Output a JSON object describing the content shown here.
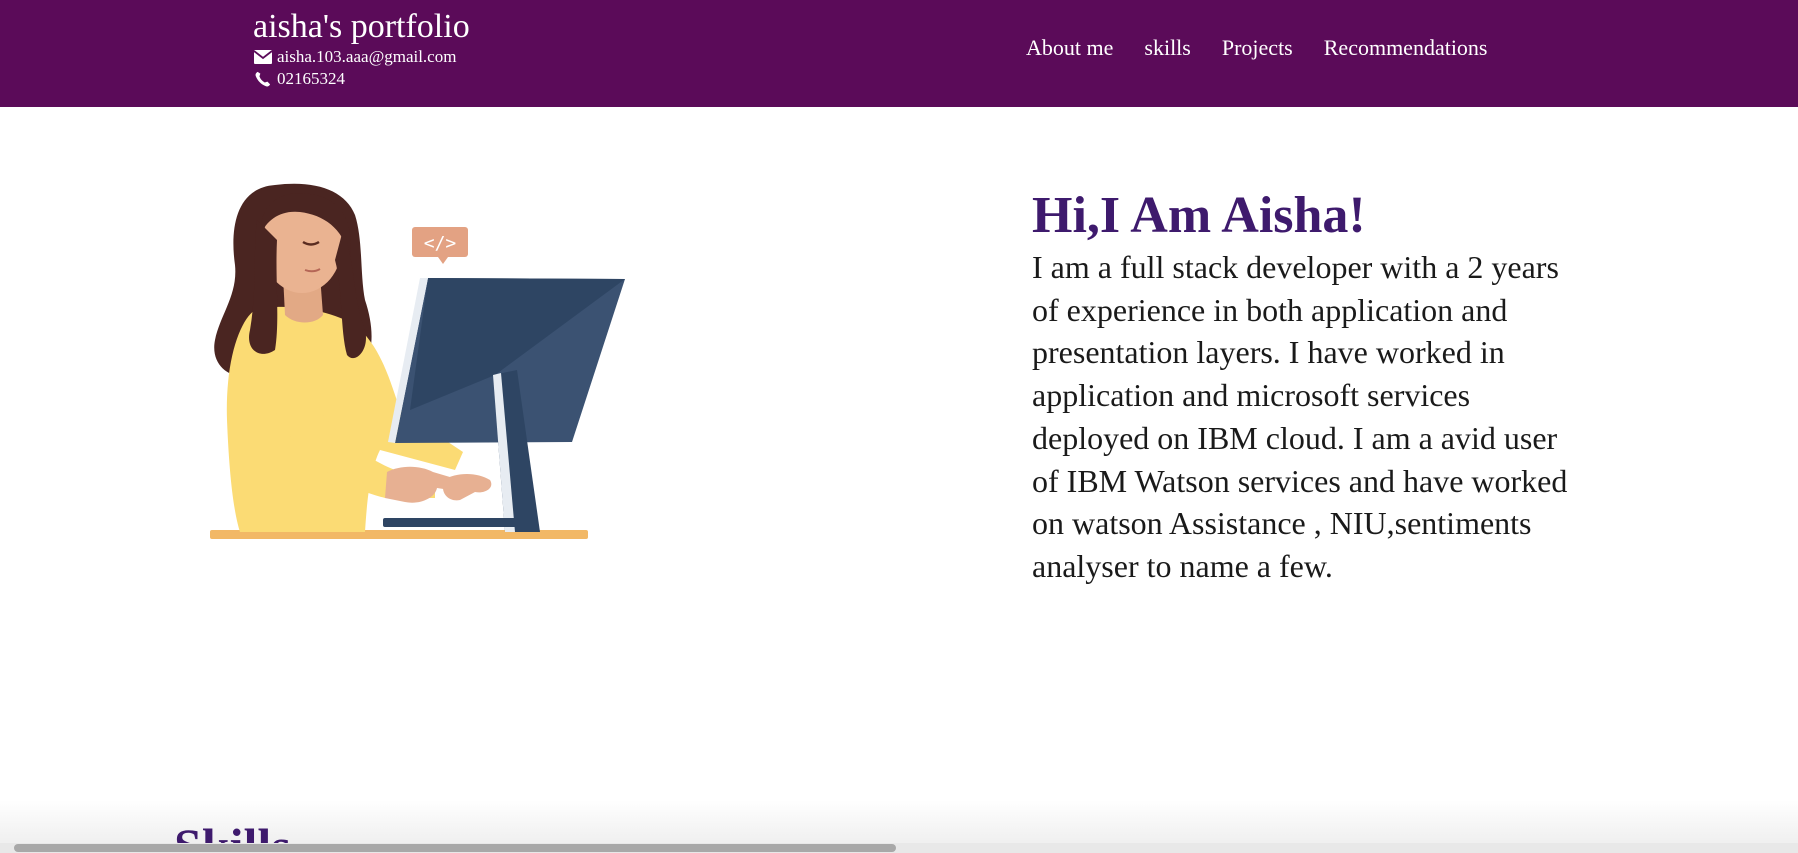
{
  "header": {
    "title": "aisha's portfolio",
    "email": "aisha.103.aaa@gmail.com",
    "phone": "02165324",
    "email_icon": "envelope-icon",
    "phone_icon": "phone-icon",
    "nav": [
      {
        "label": "About me"
      },
      {
        "label": "skills"
      },
      {
        "label": "Projects"
      },
      {
        "label": "Recommendations"
      }
    ],
    "background": "#5b0b59"
  },
  "hero": {
    "title": "Hi,I Am Aisha!",
    "body": "I am a full stack developer with a 2 years of experience in both application and presentation layers. I have worked in application and microsoft services deployed on IBM cloud. I am a avid user of IBM Watson services and have worked on watson Assistance , NIU,sentiments analyser to name a few.",
    "title_color": "#3e1a6d",
    "code_badge": "</>"
  },
  "skills": {
    "title": "Skills"
  }
}
